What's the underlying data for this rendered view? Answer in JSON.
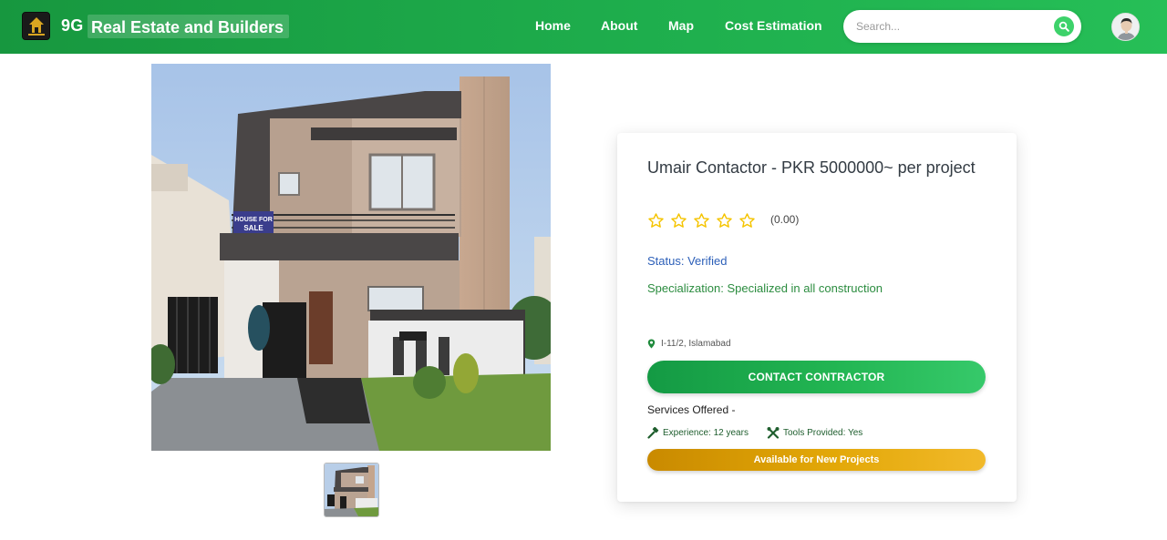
{
  "header": {
    "brand_number": "9G",
    "brand_name": "Real Estate and Builders",
    "logo_icon": "building-logo-icon",
    "nav": [
      {
        "label": "Home"
      },
      {
        "label": "About"
      },
      {
        "label": "Map"
      },
      {
        "label": "Cost Estimation"
      }
    ],
    "search_placeholder": "Search...",
    "search_icon": "search-icon",
    "avatar_icon": "user-avatar-icon",
    "brand_color": "#1fb04e"
  },
  "gallery": {
    "main_image": "house-photo",
    "thumbnail_count": 1
  },
  "contractor": {
    "title": "Umair Contactor - PKR 5000000~ per project",
    "rating": 0,
    "max_rating": 5,
    "rating_text": "(0.00)",
    "status": "Status: Verified",
    "specialization": "Specialization: Specialized in all construction",
    "location": "I-11/2, Islamabad",
    "contact_button": "CONTACT CONTRACTOR",
    "services_title": "Services Offered -",
    "experience": "Experience: 12 years",
    "tools": "Tools Provided: Yes",
    "availability": "Available for New Projects",
    "colors": {
      "status": "#2c5fb8",
      "specialization": "#2b8c3f",
      "star": "#f5c400",
      "contact": "#1fb04e",
      "availability": "#e3a808"
    }
  }
}
